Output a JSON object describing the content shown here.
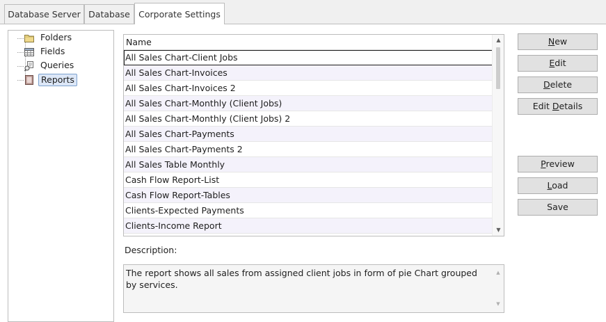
{
  "tabs": [
    {
      "label": "Database Server",
      "active": false
    },
    {
      "label": "Database",
      "active": false
    },
    {
      "label": "Corporate Settings",
      "active": true
    }
  ],
  "tree": {
    "items": [
      {
        "label": "Folders",
        "icon": "folder-icon"
      },
      {
        "label": "Fields",
        "icon": "fields-grid-icon"
      },
      {
        "label": "Queries",
        "icon": "queries-icon"
      },
      {
        "label": "Reports",
        "icon": "report-icon",
        "selected": true
      }
    ]
  },
  "list": {
    "header": "Name",
    "rows": [
      "All Sales Chart-Client Jobs",
      "All Sales Chart-Invoices",
      "All Sales Chart-Invoices 2",
      "All Sales Chart-Monthly (Client Jobs)",
      "All Sales Chart-Monthly (Client Jobs) 2",
      "All Sales Chart-Payments",
      "All Sales Chart-Payments 2",
      "All Sales Table Monthly",
      "Cash Flow Report-List",
      "Cash Flow Report-Tables",
      "Clients-Expected Payments",
      "Clients-Income Report"
    ],
    "selected_index": 0
  },
  "description": {
    "label": "Description:",
    "text": "The report shows all sales from assigned client jobs in form of pie Chart grouped by services."
  },
  "buttons": {
    "new": {
      "pre": "",
      "key": "N",
      "post": "ew"
    },
    "edit": {
      "pre": "",
      "key": "E",
      "post": "dit"
    },
    "delete": {
      "pre": "",
      "key": "D",
      "post": "elete"
    },
    "edit_details": {
      "pre": "Edit ",
      "key": "D",
      "post": "etails"
    },
    "preview": {
      "pre": "",
      "key": "P",
      "post": "review"
    },
    "load": {
      "pre": "",
      "key": "L",
      "post": "oad"
    },
    "save": {
      "pre": "Save",
      "key": "",
      "post": ""
    }
  },
  "colors": {
    "selection": "#dce7f7",
    "alt_row": "#f4f2fb",
    "button_face": "#e1e1e1"
  }
}
